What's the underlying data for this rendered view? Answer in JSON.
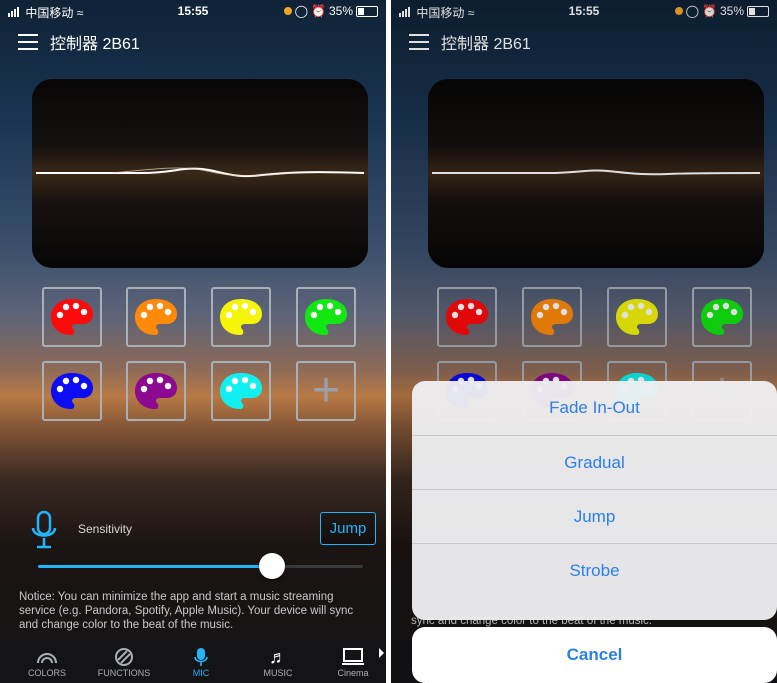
{
  "status": {
    "carrier": "中国移动",
    "time": "15:55",
    "battery": "35%"
  },
  "header": {
    "title": "控制器 2B61"
  },
  "palettes": [
    {
      "color": "#ff0a0a"
    },
    {
      "color": "#ff8a0a"
    },
    {
      "color": "#f5f50a"
    },
    {
      "color": "#11e811"
    },
    {
      "color": "#0c0cf5"
    },
    {
      "color": "#8c0a90"
    },
    {
      "color": "#11f0f0"
    }
  ],
  "controls": {
    "sensitivity_label": "Sensitivity",
    "mode_button": "Jump",
    "sensitivity_value": 0.72
  },
  "notice": "Notice: You can minimize the app and start a music streaming service (e.g. Pandora, Spotify, Apple Music). Your device will sync and change color to the beat of the music.",
  "tabs": [
    {
      "label": "COLORS",
      "icon": "rainbow-icon"
    },
    {
      "label": "FUNCTIONS",
      "icon": "stripes-icon"
    },
    {
      "label": "MIC",
      "icon": "mic-icon",
      "active": true
    },
    {
      "label": "MUSIC",
      "icon": "music-note-icon"
    },
    {
      "label": "Cinema",
      "icon": "screen-icon"
    }
  ],
  "action_sheet": {
    "options": [
      "Fade In-Out",
      "Gradual",
      "Jump",
      "Strobe"
    ],
    "cancel": "Cancel",
    "peek_text": "sync and change color to the beat of the music."
  },
  "accent_color": "#1fb6ff"
}
